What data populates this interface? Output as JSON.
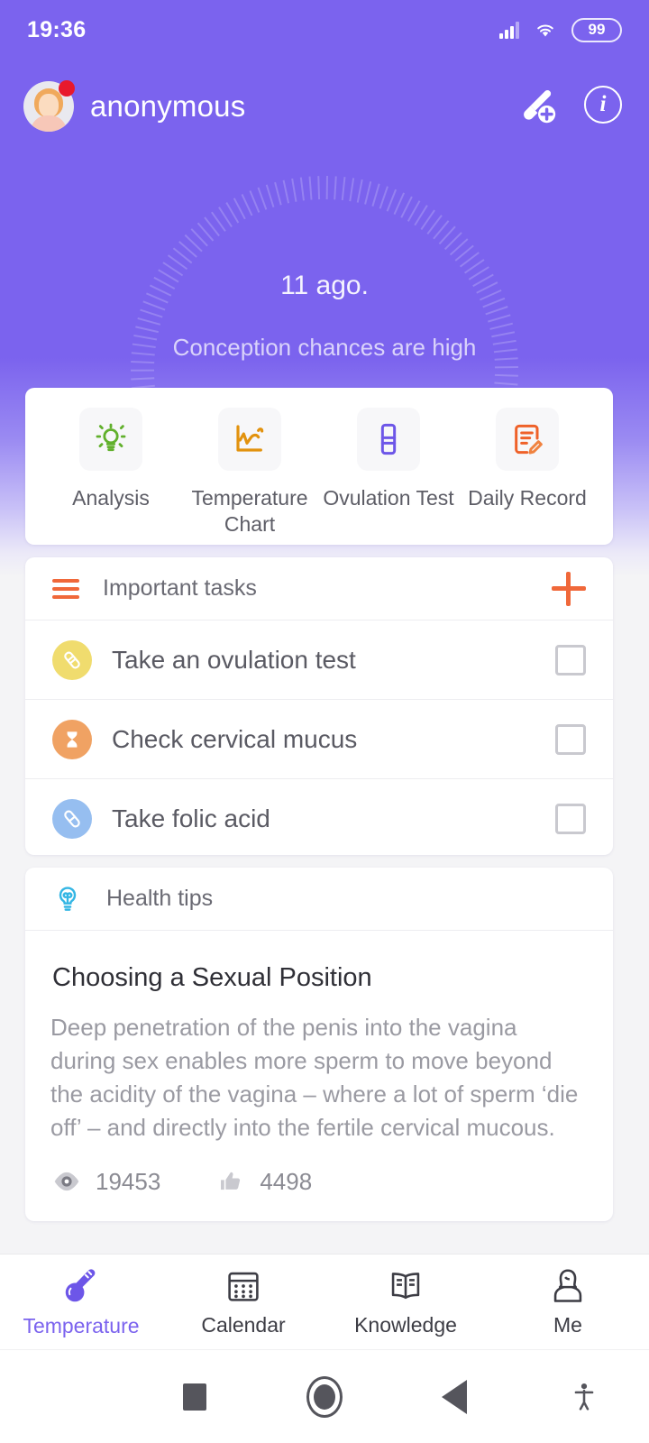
{
  "statusbar": {
    "time": "19:36",
    "battery_level": "99",
    "signal_icon": "cellular-signal-icon",
    "wifi_icon": "wifi-icon",
    "battery_icon": "battery-icon"
  },
  "appbar": {
    "username": "anonymous",
    "avatar_icon": "avatar",
    "notification_badge_icon": "notification-dot",
    "add_temperature_icon": "thermometer-add-icon",
    "info_icon": "info-icon",
    "info_glyph": "i"
  },
  "hero": {
    "days": "11 ago.",
    "subtitle": "Conception chances are high"
  },
  "quick_actions": {
    "items": [
      {
        "label": "Analysis",
        "icon": "lightbulb-icon",
        "color": "#61b02c"
      },
      {
        "label": "Temperature Chart",
        "icon": "line-chart-icon",
        "color": "#e2920e"
      },
      {
        "label": "Ovulation Test",
        "icon": "test-strip-icon",
        "color": "#6d56e8"
      },
      {
        "label": "Daily Record",
        "icon": "note-edit-icon",
        "color": "#ef6129"
      }
    ]
  },
  "tasks": {
    "header": "Important tasks",
    "list_icon": "list-icon",
    "add_icon": "plus-icon",
    "accent": "#f0683a",
    "items": [
      {
        "label": "Take an ovulation test",
        "icon": "test-strip-icon",
        "circle": "#f0dc6e",
        "checked": false
      },
      {
        "label": "Check cervical mucus",
        "icon": "hourglass-icon",
        "circle": "#f0a263",
        "checked": false
      },
      {
        "label": "Take folic acid",
        "icon": "pill-icon",
        "circle": "#96bef0",
        "checked": false
      }
    ]
  },
  "tips": {
    "header": "Health tips",
    "header_icon": "lightbulb-outline-icon",
    "title": "Choosing a Sexual Position",
    "body": "Deep penetration of the penis into the vagina during sex enables more sperm to move beyond the acidity of the vagina – where a lot of sperm ‘die off’ – and directly into the fertile cervical mucous.",
    "views_icon": "eye-icon",
    "views": "19453",
    "likes_icon": "thumbs-up-icon",
    "likes": "4498"
  },
  "bottomnav": {
    "active_color": "#7b63ee",
    "items": [
      {
        "label": "Temperature",
        "icon": "thermometer-icon",
        "active": true
      },
      {
        "label": "Calendar",
        "icon": "calendar-icon",
        "active": false
      },
      {
        "label": "Knowledge",
        "icon": "book-icon",
        "active": false
      },
      {
        "label": "Me",
        "icon": "person-icon",
        "active": false
      }
    ]
  },
  "sysnav": {
    "recents_icon": "recents-square-icon",
    "home_icon": "home-circle-icon",
    "back_icon": "back-triangle-icon",
    "accessibility_icon": "accessibility-icon"
  }
}
